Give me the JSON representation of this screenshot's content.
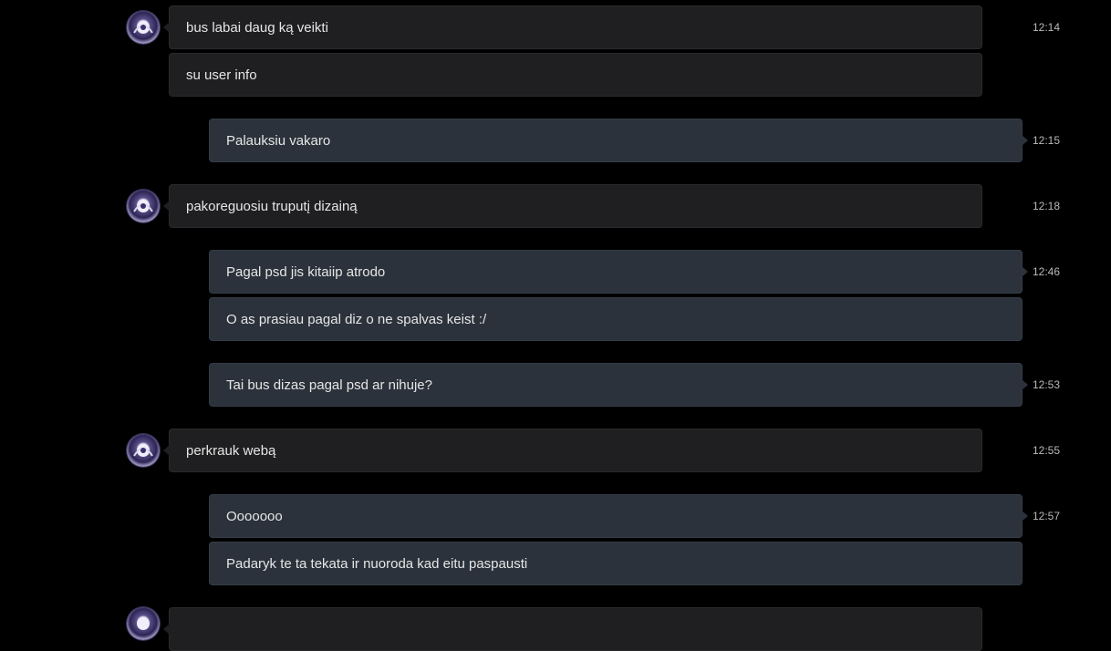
{
  "messages": [
    {
      "text": "bus labai daug ką veikti",
      "time": "12:14",
      "direction": "incoming"
    },
    {
      "text": "su user info",
      "time": "",
      "direction": "incoming"
    },
    {
      "text": "Palauksiu vakaro",
      "time": "12:15",
      "direction": "outgoing"
    },
    {
      "text": "pakoreguosiu truputį dizainą",
      "time": "12:18",
      "direction": "incoming"
    },
    {
      "text": "Pagal psd jis kitaiip atrodo",
      "time": "12:46",
      "direction": "outgoing"
    },
    {
      "text": "O as prasiau pagal diz o ne spalvas keist :/",
      "time": "",
      "direction": "outgoing"
    },
    {
      "text": "Tai bus dizas pagal psd ar nihuje?",
      "time": "12:53",
      "direction": "outgoing"
    },
    {
      "text": "perkrauk webą",
      "time": "12:55",
      "direction": "incoming"
    },
    {
      "text": "Ooooooo",
      "time": "12:57",
      "direction": "outgoing"
    },
    {
      "text": "Padaryk te ta tekata ir nuoroda kad eitu paspausti",
      "time": "",
      "direction": "outgoing"
    },
    {
      "text": "",
      "time": "",
      "direction": "incoming"
    }
  ],
  "colors": {
    "background": "#000000",
    "incoming_bubble": "#1f1f21",
    "outgoing_bubble": "#2b323b",
    "text": "#e6e6e6",
    "timestamp": "#b9b9b9"
  },
  "avatar_icon": "contact-avatar-icon"
}
